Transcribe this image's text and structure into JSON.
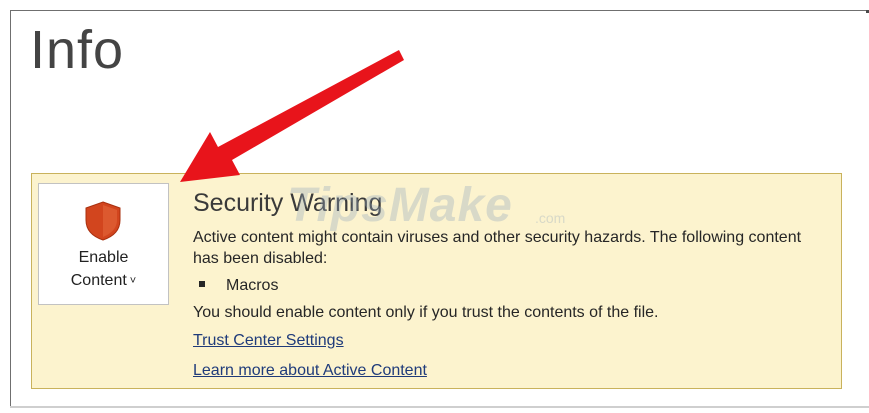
{
  "page": {
    "title": "Info"
  },
  "security_warning": {
    "enable_button": {
      "line1": "Enable",
      "line2": "Content",
      "chevron": "˅",
      "icon": "shield-icon"
    },
    "title": "Security Warning",
    "description": "Active content might contain viruses and other security hazards. The following content has been disabled:",
    "disabled_items": [
      "Macros"
    ],
    "note": "You should enable content only if you trust the contents of the file.",
    "links": {
      "trust_center": "Trust Center Settings",
      "learn_more": "Learn more about Active Content"
    }
  },
  "watermark": {
    "text": "TipsMake",
    "suffix": ".com"
  },
  "colors": {
    "panel_background": "#fcf3ce",
    "panel_border": "#c9b25c",
    "shield": "#d2451e",
    "arrow": "#e8141b",
    "link": "#1f3b7a"
  }
}
